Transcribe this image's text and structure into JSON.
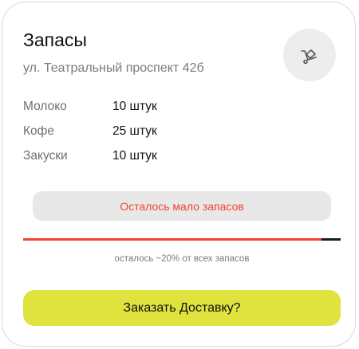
{
  "card": {
    "title": "Запасы",
    "address": "ул. Театральный проспект 42б",
    "action_icon": "cart-icon"
  },
  "stock": [
    {
      "name": "Молоко",
      "qty": "10 штук"
    },
    {
      "name": "Кофе",
      "qty": "25 штук"
    },
    {
      "name": "Закуски",
      "qty": "10 штук"
    }
  ],
  "warning": {
    "text": "Осталось мало запасов"
  },
  "progress": {
    "fraction": 0.94,
    "caption": "осталось ~20% от всех запасов"
  },
  "order": {
    "label": "Заказать Доставку?"
  },
  "colors": {
    "accent": "#e0e23d",
    "warning": "#f2432f",
    "pill": "#e8e8e8",
    "icon_bg": "#ededed"
  }
}
